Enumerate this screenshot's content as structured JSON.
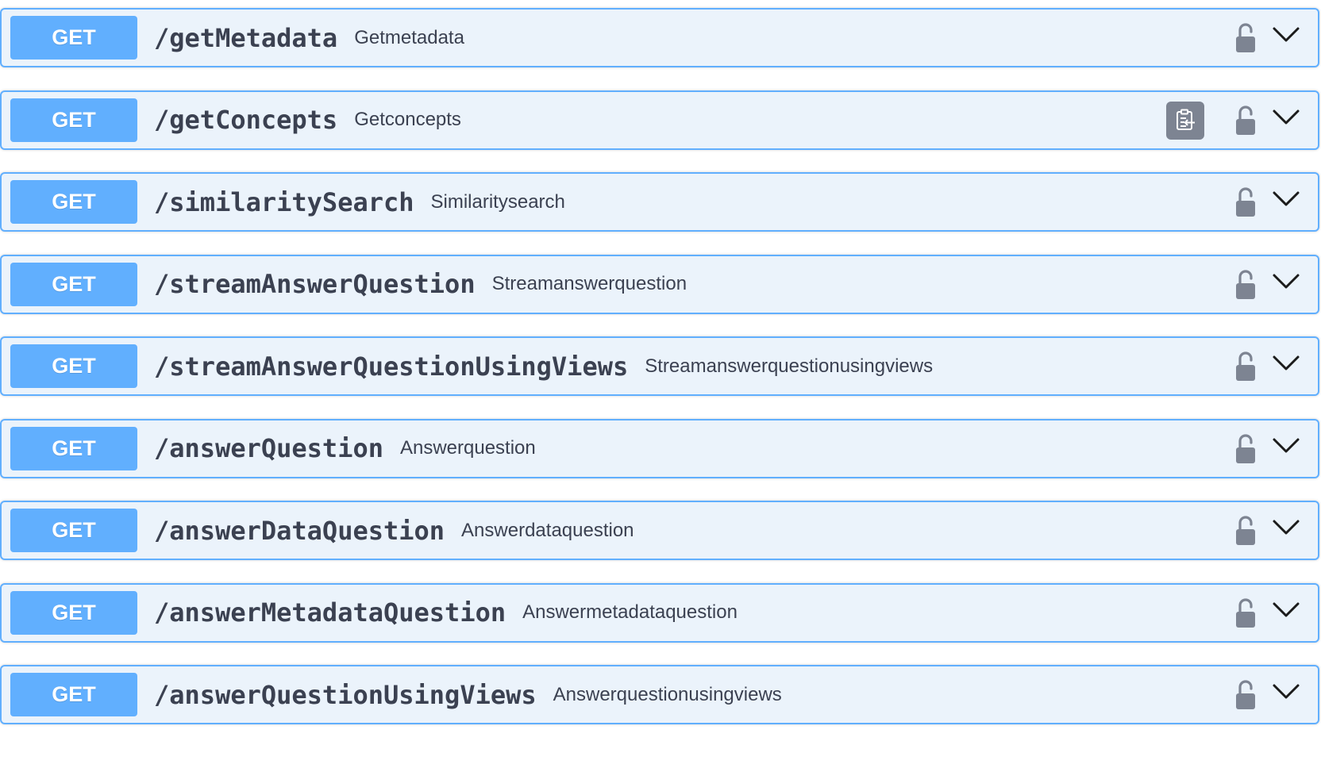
{
  "operations": [
    {
      "method": "GET",
      "path": "/getMetadata",
      "summary": "Getmetadata",
      "show_copy": false
    },
    {
      "method": "GET",
      "path": "/getConcepts",
      "summary": "Getconcepts",
      "show_copy": true
    },
    {
      "method": "GET",
      "path": "/similaritySearch",
      "summary": "Similaritysearch",
      "show_copy": false
    },
    {
      "method": "GET",
      "path": "/streamAnswerQuestion",
      "summary": "Streamanswerquestion",
      "show_copy": false
    },
    {
      "method": "GET",
      "path": "/streamAnswerQuestionUsingViews",
      "summary": "Streamanswerquestionusingviews",
      "show_copy": false
    },
    {
      "method": "GET",
      "path": "/answerQuestion",
      "summary": "Answerquestion",
      "show_copy": false
    },
    {
      "method": "GET",
      "path": "/answerDataQuestion",
      "summary": "Answerdataquestion",
      "show_copy": false
    },
    {
      "method": "GET",
      "path": "/answerMetadataQuestion",
      "summary": "Answermetadataquestion",
      "show_copy": false
    },
    {
      "method": "GET",
      "path": "/answerQuestionUsingViews",
      "summary": "Answerquestionusingviews",
      "show_copy": false
    }
  ],
  "icons": {
    "lock": "unlocked-padlock-icon",
    "expand": "chevron-down-icon",
    "copy": "clipboard-copy-icon"
  },
  "colors": {
    "get_accent": "#61affe",
    "get_background": "#ebf3fb",
    "text": "#3b4151",
    "copy_button": "#7d8492",
    "lock_icon": "#7d8492"
  }
}
